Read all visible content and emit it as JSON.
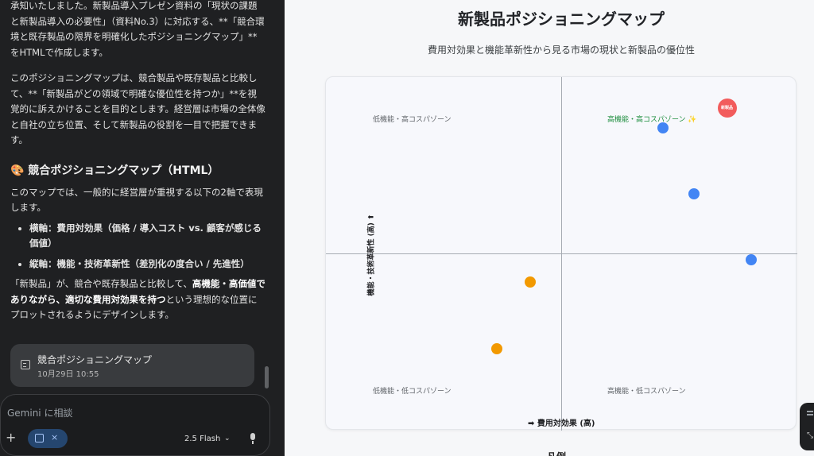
{
  "chat": {
    "paragraphs": {
      "p1": "承知いたしました。新製品導入プレゼン資料の「現状の課題と新製品導入の必要性」（資料No.3）に対応する、**「競合環境と既存製品の限界を明確化したポジショニングマップ」**をHTMLで作成します。",
      "p2": "このポジショニングマップは、競合製品や既存製品と比較して、**「新製品がどの領域で明確な優位性を持つか」**を視覚的に訴えかけることを目的とします。経営層は市場の全体像と自社の立ち位置、そして新製品の役割を一目で把握できます。",
      "heading": "🎨 競合ポジショニングマップ（HTML）",
      "p3": "このマップでは、一般的に経営層が重視する以下の2軸で表現します。",
      "bullets": [
        "横軸：費用対効果（価格 / 導入コスト vs. 顧客が感じる価値）",
        "縦軸：機能・技術革新性（差別化の度合い / 先進性）"
      ],
      "p4_a": "「新製品」が、競合や既存製品と比較して、",
      "p4_b": "高機能・高価値でありながら、適切な費用対効果を持つ",
      "p4_c": "という理想的な位置にプロットされるようにデザインします。"
    },
    "doc_card": {
      "title": "競合ポジショニングマップ",
      "date": "10月29日 10:55"
    },
    "input": {
      "placeholder": "Gemini に相談",
      "plus_icon": "plus-icon",
      "tool_close": "×",
      "model_label": "2.5 Flash",
      "model_chevron": "⌄"
    }
  },
  "map": {
    "title": "新製品ポジショニングマップ",
    "subtitle": "費用対効果と機能革新性から見る市場の現状と新製品の優位性",
    "zones": {
      "top_left": "低機能・高コスパゾーン",
      "top_right": "高機能・高コスパゾーン ✨",
      "bottom_left": "低機能・低コスパゾーン",
      "bottom_right": "高機能・低コスパゾーン"
    },
    "y_axis_label": "機能・技術革新性 (高) ⬆",
    "x_axis_label": "➡ 費用対効果 (高)",
    "new_product_label": "新製品",
    "legend_title": "凡例",
    "colors": {
      "new_product": "#f25c5c",
      "competitor": "#4285f4",
      "existing": "#f29900",
      "highlight_zone": "#1e8e3e"
    }
  },
  "chart_data": {
    "type": "scatter",
    "xlabel": "➡ 費用対効果 (高)",
    "ylabel": "機能・技術革新性 (高) ⬆",
    "series": [
      {
        "color": "#4285f4",
        "points": [
          {
            "x": 46,
            "y": 57
          },
          {
            "x": 60,
            "y": 27
          },
          {
            "x": 86,
            "y": -3
          }
        ]
      },
      {
        "color": "#f29900",
        "points": [
          {
            "x": -14,
            "y": -13
          },
          {
            "x": -29,
            "y": -43
          }
        ]
      },
      {
        "color": "#f25c5c",
        "points": [
          {
            "x": 75,
            "y": 66
          }
        ]
      }
    ]
  }
}
